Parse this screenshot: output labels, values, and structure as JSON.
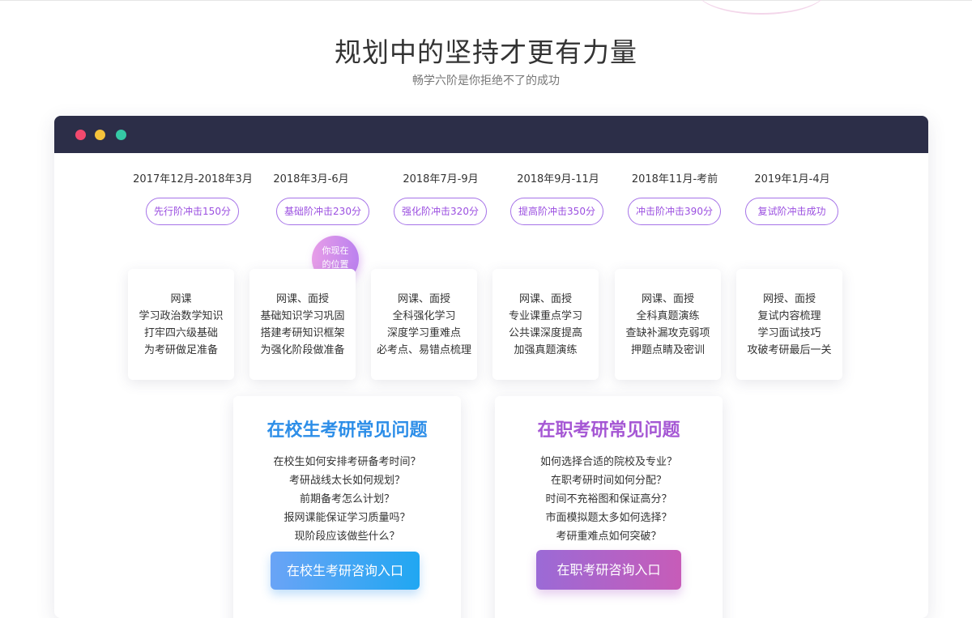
{
  "header": {
    "title": "规划中的坚持才更有力量",
    "subtitle": "畅学六阶是你拒绝不了的成功"
  },
  "colors": {
    "window_bar": "#2c2e48",
    "accent_purple": "#9b4fe0",
    "student_blue": "#2d8ee8",
    "worker_purple": "#a557d4"
  },
  "window": {
    "controls": [
      "close-dot",
      "minimize-dot",
      "maximize-dot"
    ]
  },
  "stages": [
    {
      "date": "2017年12月-2018年3月",
      "label": "先行阶冲击150分",
      "lines": [
        "网课",
        "学习政治数学知识",
        "打牢四六级基础",
        "为考研做足准备"
      ]
    },
    {
      "date": "2018年3月-6月",
      "label": "基础阶冲击230分",
      "lines": [
        "网课、面授",
        "基础知识学习巩固",
        "搭建考研知识框架",
        "为强化阶段做准备"
      ]
    },
    {
      "date": "2018年7月-9月",
      "label": "强化阶冲击320分",
      "lines": [
        "网课、面授",
        "全科强化学习",
        "深度学习重难点",
        "必考点、易错点梳理"
      ]
    },
    {
      "date": "2018年9月-11月",
      "label": "提高阶冲击350分",
      "lines": [
        "网课、面授",
        "专业课重点学习",
        "公共课深度提高",
        "加强真题演练"
      ]
    },
    {
      "date": "2018年11月-考前",
      "label": "冲击阶冲击390分",
      "lines": [
        "网课、面授",
        "全科真题演练",
        "查缺补漏攻克弱项",
        "押题点睛及密训"
      ]
    },
    {
      "date": "2019年1月-4月",
      "label": "复试阶冲击成功",
      "lines": [
        "网授、面授",
        "复试内容梳理",
        "学习面试技巧",
        "攻破考研最后一关"
      ]
    }
  ],
  "current_marker": {
    "line1": "你现在",
    "line2": "的位置"
  },
  "faq": {
    "student": {
      "title": "在校生考研常见问题",
      "items": [
        "在校生如何安排考研备考时间？",
        "考研战线太长如何规划？",
        "前期备考怎么计划？",
        "报网课能保证学习质量吗？",
        "现阶段应该做些什么？"
      ],
      "button": "在校生考研咨询入口"
    },
    "worker": {
      "title": "在职考研常见问题",
      "items": [
        "如何选择合适的院校及专业？",
        "在职考研时间如何分配？",
        "时间不充裕图和保证高分？",
        "市面模拟题太多如何选择？",
        "考研重难点如何突破？"
      ],
      "button": "在职考研咨询入口"
    }
  }
}
